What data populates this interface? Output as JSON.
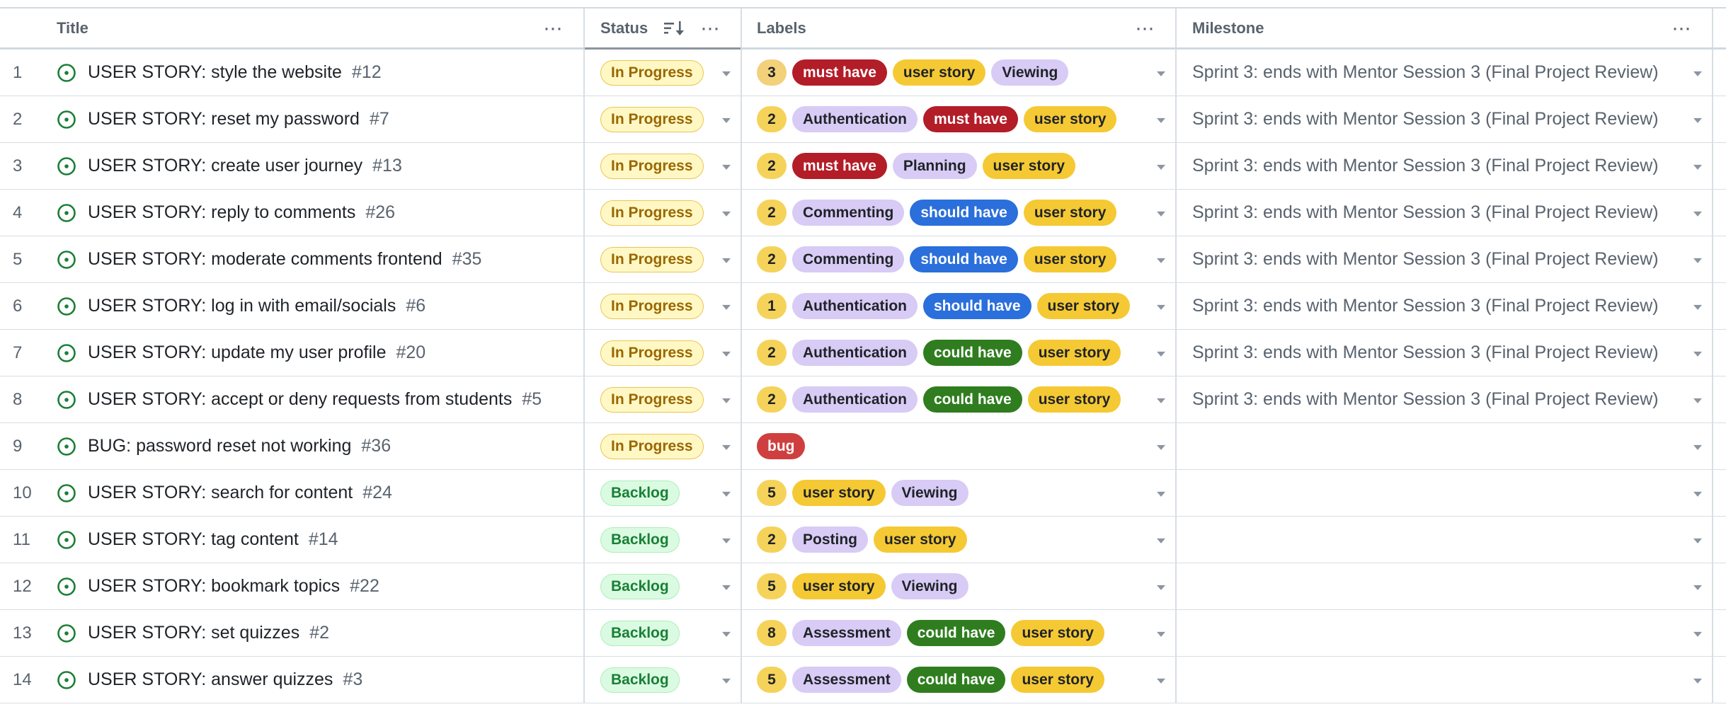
{
  "header": {
    "title": "Title",
    "status": "Status",
    "labels": "Labels",
    "milestone": "Milestone"
  },
  "label_colors": {
    "1": {
      "bg": "#f5d35a",
      "fg": "#1f2328"
    },
    "2": {
      "bg": "#f5d35a",
      "fg": "#1f2328"
    },
    "3": {
      "bg": "#f2d17a",
      "fg": "#1f2328"
    },
    "5": {
      "bg": "#f5d35a",
      "fg": "#1f2328"
    },
    "8": {
      "bg": "#f5d35a",
      "fg": "#1f2328"
    },
    "must have": {
      "bg": "#b31d28",
      "fg": "#ffffff"
    },
    "user story": {
      "bg": "#f5c933",
      "fg": "#1f2328"
    },
    "Viewing": {
      "bg": "#d8cbf5",
      "fg": "#1f2328"
    },
    "Authentication": {
      "bg": "#d8cbf5",
      "fg": "#1f2328"
    },
    "Planning": {
      "bg": "#d8cbf5",
      "fg": "#1f2328"
    },
    "Commenting": {
      "bg": "#d8cbf5",
      "fg": "#1f2328"
    },
    "Posting": {
      "bg": "#d8cbf5",
      "fg": "#1f2328"
    },
    "Assessment": {
      "bg": "#d8cbf5",
      "fg": "#1f2328"
    },
    "should have": {
      "bg": "#2a6fdb",
      "fg": "#ffffff"
    },
    "could have": {
      "bg": "#2f7d1f",
      "fg": "#ffffff"
    },
    "bug": {
      "bg": "#cf3f3f",
      "fg": "#ffffff"
    }
  },
  "rows": [
    {
      "index": "1",
      "title": "USER STORY: style the website",
      "number": "#12",
      "status": "In Progress",
      "labels": [
        "3",
        "must have",
        "user story",
        "Viewing"
      ],
      "milestone": "Sprint 3: ends with Mentor Session 3 (Final Project Review)"
    },
    {
      "index": "2",
      "title": "USER STORY: reset my password",
      "number": "#7",
      "status": "In Progress",
      "labels": [
        "2",
        "Authentication",
        "must have",
        "user story"
      ],
      "milestone": "Sprint 3: ends with Mentor Session 3 (Final Project Review)"
    },
    {
      "index": "3",
      "title": "USER STORY: create user journey",
      "number": "#13",
      "status": "In Progress",
      "labels": [
        "2",
        "must have",
        "Planning",
        "user story"
      ],
      "milestone": "Sprint 3: ends with Mentor Session 3 (Final Project Review)"
    },
    {
      "index": "4",
      "title": "USER STORY: reply to comments",
      "number": "#26",
      "status": "In Progress",
      "labels": [
        "2",
        "Commenting",
        "should have",
        "user story"
      ],
      "milestone": "Sprint 3: ends with Mentor Session 3 (Final Project Review)"
    },
    {
      "index": "5",
      "title": "USER STORY: moderate comments frontend",
      "number": "#35",
      "status": "In Progress",
      "labels": [
        "2",
        "Commenting",
        "should have",
        "user story"
      ],
      "milestone": "Sprint 3: ends with Mentor Session 3 (Final Project Review)"
    },
    {
      "index": "6",
      "title": "USER STORY: log in with email/socials",
      "number": "#6",
      "status": "In Progress",
      "labels": [
        "1",
        "Authentication",
        "should have",
        "user story"
      ],
      "milestone": "Sprint 3: ends with Mentor Session 3 (Final Project Review)"
    },
    {
      "index": "7",
      "title": "USER STORY: update my user profile",
      "number": "#20",
      "status": "In Progress",
      "labels": [
        "2",
        "Authentication",
        "could have",
        "user story"
      ],
      "milestone": "Sprint 3: ends with Mentor Session 3 (Final Project Review)"
    },
    {
      "index": "8",
      "title": "USER STORY: accept or deny requests from students",
      "number": "#5",
      "status": "In Progress",
      "labels": [
        "2",
        "Authentication",
        "could have",
        "user story"
      ],
      "milestone": "Sprint 3: ends with Mentor Session 3 (Final Project Review)"
    },
    {
      "index": "9",
      "title": "BUG: password reset not working",
      "number": "#36",
      "status": "In Progress",
      "labels": [
        "bug"
      ],
      "milestone": ""
    },
    {
      "index": "10",
      "title": "USER STORY: search for content",
      "number": "#24",
      "status": "Backlog",
      "labels": [
        "5",
        "user story",
        "Viewing"
      ],
      "milestone": ""
    },
    {
      "index": "11",
      "title": "USER STORY: tag content",
      "number": "#14",
      "status": "Backlog",
      "labels": [
        "2",
        "Posting",
        "user story"
      ],
      "milestone": ""
    },
    {
      "index": "12",
      "title": "USER STORY: bookmark topics",
      "number": "#22",
      "status": "Backlog",
      "labels": [
        "5",
        "user story",
        "Viewing"
      ],
      "milestone": ""
    },
    {
      "index": "13",
      "title": "USER STORY: set quizzes",
      "number": "#2",
      "status": "Backlog",
      "labels": [
        "8",
        "Assessment",
        "could have",
        "user story"
      ],
      "milestone": ""
    },
    {
      "index": "14",
      "title": "USER STORY: answer quizzes",
      "number": "#3",
      "status": "Backlog",
      "labels": [
        "5",
        "Assessment",
        "could have",
        "user story"
      ],
      "milestone": ""
    }
  ]
}
